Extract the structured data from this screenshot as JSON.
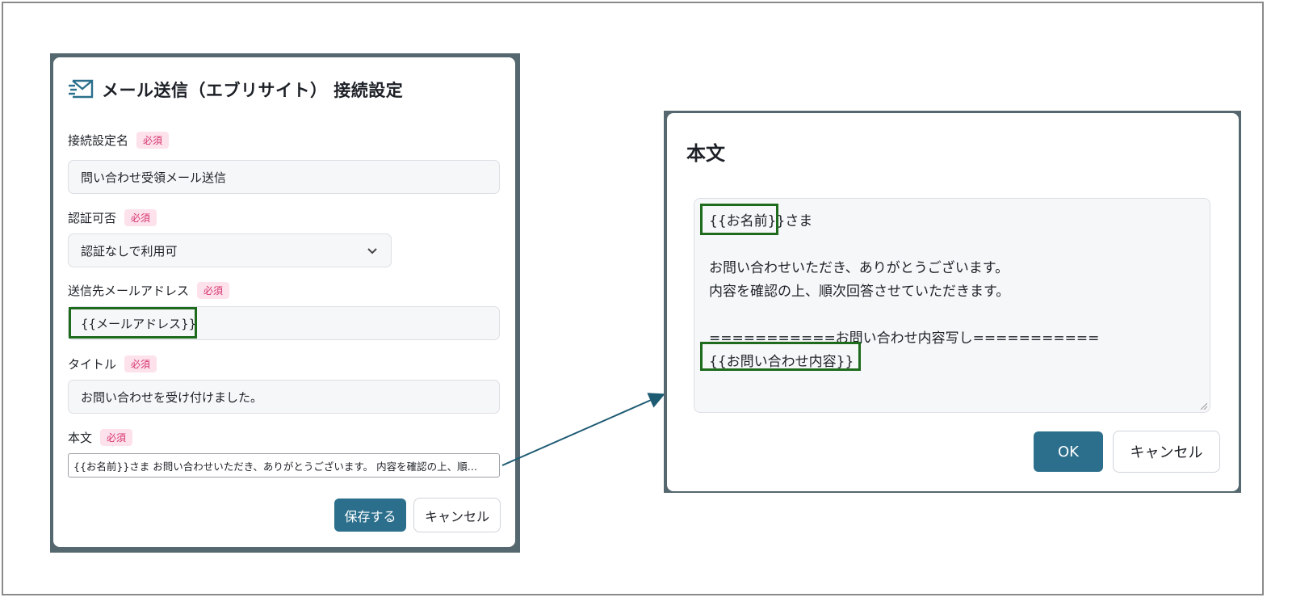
{
  "left_dialog": {
    "title": "メール送信（エブリサイト） 接続設定",
    "required_badge": "必須",
    "fields": {
      "connection_name": {
        "label": "接続設定名",
        "value": "問い合わせ受領メール送信"
      },
      "auth": {
        "label": "認証可否",
        "value": "認証なしで利用可"
      },
      "recipient": {
        "label": "送信先メールアドレス",
        "value": "{{メールアドレス}}"
      },
      "title": {
        "label": "タイトル",
        "value": "お問い合わせを受け付けました。"
      },
      "body": {
        "label": "本文",
        "value": "{{お名前}}さま お問い合わせいただき、ありがとうございます。 内容を確認の上、順…"
      }
    },
    "save_label": "保存する",
    "cancel_label": "キャンセル"
  },
  "right_dialog": {
    "title": "本文",
    "body_lines": {
      "l1_var": "{{お名前}}",
      "l1_rest": "さま",
      "l2": "",
      "l3": "お問い合わせいただき、ありがとうございます。",
      "l4": "内容を確認の上、順次回答させていただきます。",
      "l5": "",
      "l6": "===========お問い合わせ内容写し===========",
      "l7_var": "{{お問い合わせ内容}}"
    },
    "ok_label": "OK",
    "cancel_label": "キャンセル"
  },
  "colors": {
    "primary": "#2b6f8c",
    "highlight": "#1e6b1e",
    "required_text": "#d6336c",
    "required_bg": "#fde2ec",
    "backdrop": "#55676f",
    "arrow": "#1d5b73"
  },
  "icons": {
    "header": "mail-icon",
    "select": "chevron-down-icon",
    "textarea": "resize-grip-icon"
  }
}
